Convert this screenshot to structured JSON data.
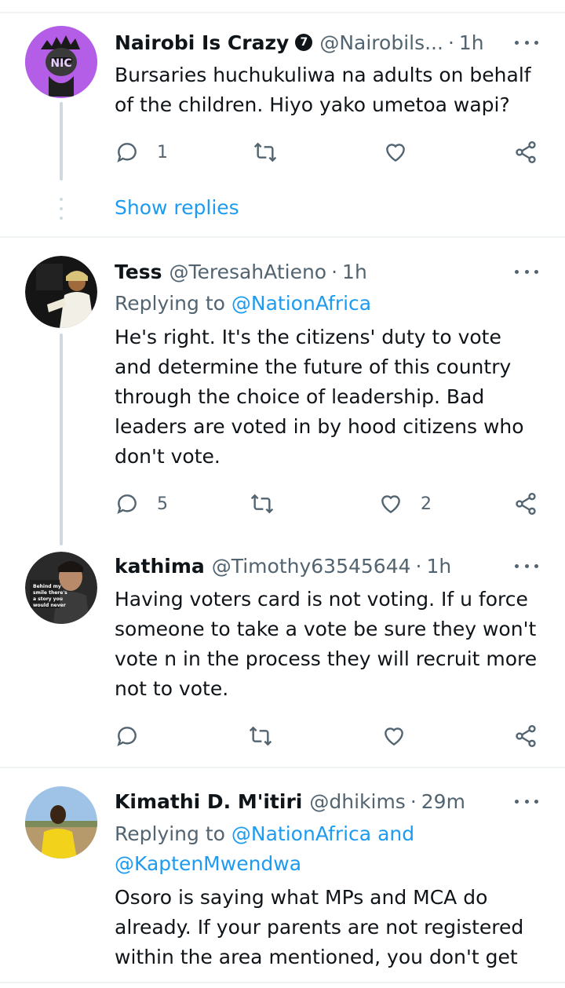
{
  "tweets": [
    {
      "name": "Nairobi Is Crazy",
      "badge": "7",
      "handle": "@Nairobils...",
      "time": "1h",
      "avatar_text": "NIC",
      "text": "Bursaries huchukuliwa na adults on behalf of the children. Hiyo yako umetoa wapi?",
      "reply_count": "1",
      "retweet_count": "",
      "like_count": "",
      "show_replies": "Show replies"
    },
    {
      "name": "Tess",
      "handle": "@TeresahAtieno",
      "time": "1h",
      "replying_prefix": "Replying to",
      "replying_mention": "@NationAfrica",
      "text": "He's right. It's the citizens' duty to vote and determine the future of this country through the choice of leadership. Bad leaders are voted in by hood citizens who don't vote.",
      "reply_count": "5",
      "retweet_count": "",
      "like_count": "2"
    },
    {
      "name": "kathima",
      "handle": "@Timothy63545644",
      "time": "1h",
      "avatar_text": "Behind my smile there's a story you would never understand",
      "text": "Having voters card is not voting. If u force someone to take a vote be sure they won't vote n in the process they will recruit more not to vote.",
      "reply_count": "",
      "retweet_count": "",
      "like_count": ""
    },
    {
      "name": "Kimathi D. M'itiri",
      "handle": "@dhikims",
      "time": "29m",
      "replying_prefix": "Replying to",
      "replying_mention": "@NationAfrica and",
      "replying_mention_2": "@KaptenMwendwa",
      "text": "Osoro is saying what MPs and MCA do already. If your parents are not registered within the area mentioned, you don't get"
    }
  ],
  "colors": {
    "accent": "#1d9bf0",
    "muted": "#536471",
    "text": "#0f1419",
    "line": "#cfd9de"
  }
}
